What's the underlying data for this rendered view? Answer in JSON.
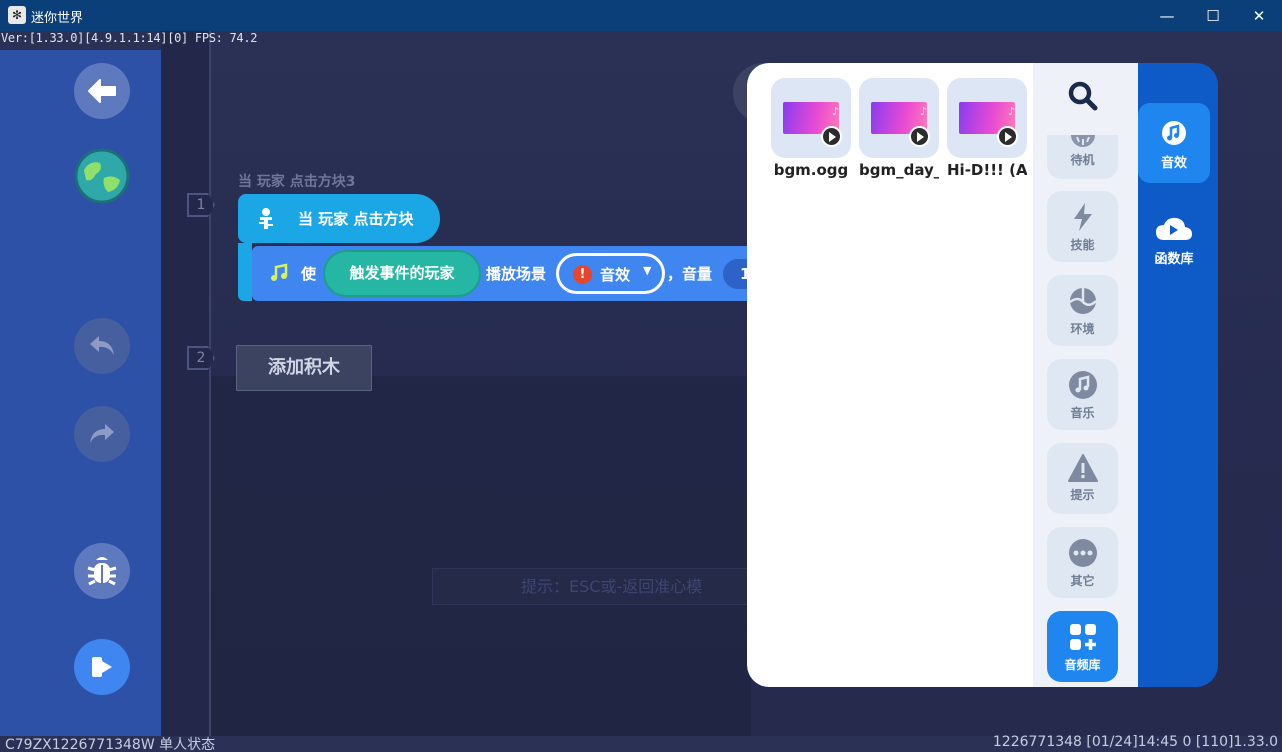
{
  "window": {
    "title": "迷你世界",
    "app_icon": "mini-world-logo",
    "minimize": "—",
    "maximize": "☐",
    "close": "✕"
  },
  "debug": {
    "version": "Ver:[1.33.0][4.9.1.1:14][0] FPS: 74.2"
  },
  "sidebar": {
    "buttons": [
      {
        "name": "back",
        "icon": "arrow-left-icon"
      },
      {
        "name": "world",
        "icon": "globe-icon"
      },
      {
        "name": "undo",
        "icon": "undo-icon"
      },
      {
        "name": "redo",
        "icon": "redo-icon"
      },
      {
        "name": "debug",
        "icon": "bug-icon"
      },
      {
        "name": "run",
        "icon": "play-icon"
      }
    ]
  },
  "script": {
    "line_numbers": [
      "1",
      "2"
    ],
    "event_caption": "当 玩家 点击方块3",
    "event_label": "当 玩家 点击方块",
    "action": {
      "verb": "使",
      "target": "触发事件的玩家",
      "text_play": "播放场景",
      "sound_value": "音效",
      "text_volume": "，音量",
      "volume_value": "1"
    },
    "add_block": "添加积木"
  },
  "hint": "提示：ESC或-返回准心模",
  "panel": {
    "sounds": [
      {
        "name": "bgm.ogg"
      },
      {
        "name": "bgm_day_"
      },
      {
        "name": "Hi-D!!! (A"
      }
    ],
    "categories": [
      {
        "label": "待机",
        "icon": "idle-icon"
      },
      {
        "label": "技能",
        "icon": "lightning-icon"
      },
      {
        "label": "环境",
        "icon": "environment-icon"
      },
      {
        "label": "音乐",
        "icon": "music-note-icon"
      },
      {
        "label": "提示",
        "icon": "warning-icon"
      },
      {
        "label": "其它",
        "icon": "more-icon"
      },
      {
        "label": "音频库",
        "icon": "library-icon"
      }
    ],
    "tabs": [
      {
        "label": "音效",
        "icon": "music-note-icon"
      },
      {
        "label": "函数库",
        "icon": "cloud-play-icon"
      }
    ]
  },
  "status": {
    "left": "C79ZX1226771348W 单人状态",
    "right": "1226771348   [01/24]14:45 0   [110]1.33.0"
  },
  "colors": {
    "accent": "#3f86f0",
    "event": "#1ba6e6",
    "player_pill": "#25b7a3",
    "panel_blue": "#0e5bc7",
    "warn": "#e8442e"
  }
}
